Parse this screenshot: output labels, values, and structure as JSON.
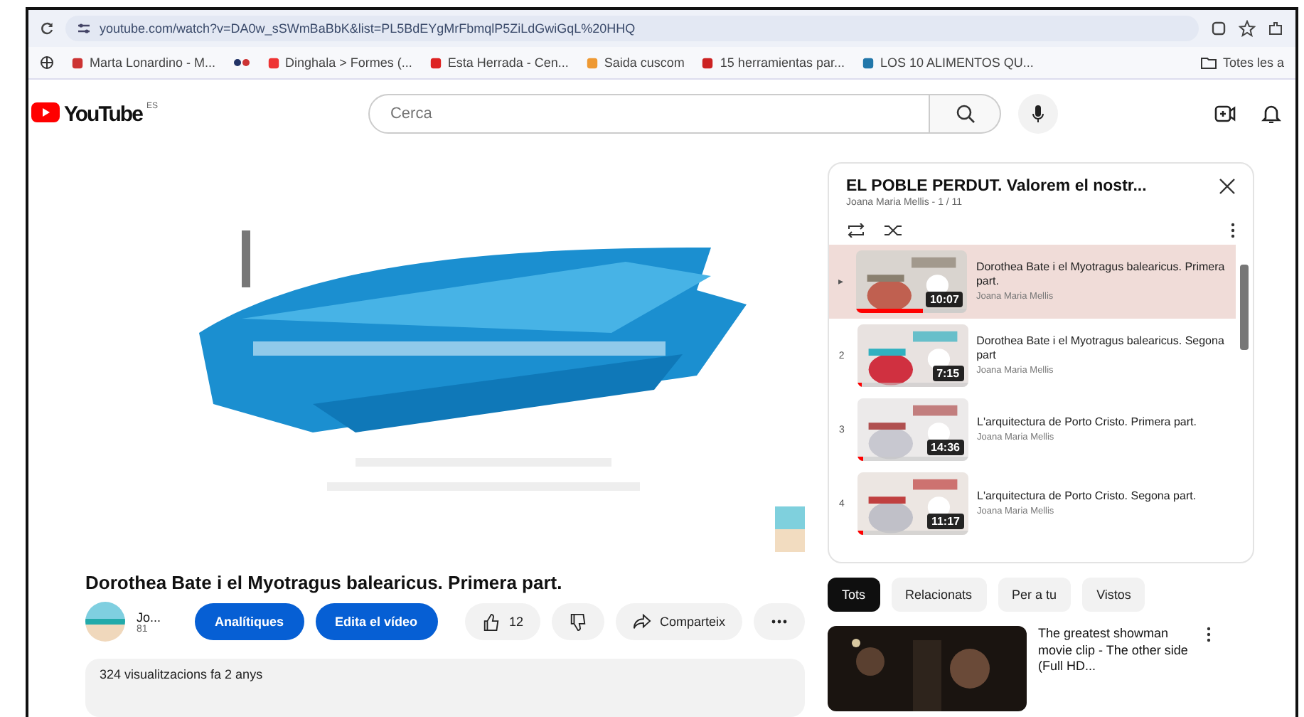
{
  "browser": {
    "url": "youtube.com/watch?v=DA0w_sSWmBaBbK&list=PL5BdEYgMrFbmqlP5ZiLdGwiGqL%20HHQ",
    "bookmarks": [
      {
        "label": "Marta Lonardino - M..."
      },
      {
        "label": "Dinghala > Formes (..."
      },
      {
        "label": "Esta Herrada - Cen..."
      },
      {
        "label": "Saida cuscom"
      },
      {
        "label": "15 herramientas par..."
      },
      {
        "label": "LOS 10 ALIMENTOS QU..."
      }
    ],
    "folder": "Totes les a"
  },
  "header": {
    "logo": "YouTube",
    "region": "ES",
    "search_placeholder": "Cerca"
  },
  "video": {
    "title": "Dorothea Bate i el Myotragus balearicus. Primera part.",
    "channel": "Jo...",
    "subscribers": "81",
    "buttons": [
      "Analítiques",
      "Edita el vídeo"
    ],
    "likes": "12",
    "share": "Comparteix",
    "description": "324 visualitzacions fa 2 anys"
  },
  "playlist": {
    "title": "EL POBLE PERDUT. Valorem el nostr...",
    "subtitle": "Joana Maria Mellis - 1 / 11",
    "items": [
      {
        "marker": "▸",
        "title": "Dorothea Bate i el Myotragus balearicus. Primera part.",
        "channel": "Joana Maria Mellis",
        "duration": "10:07",
        "selected": true,
        "level": 0.6
      },
      {
        "marker": "2",
        "title": "Dorothea Bate i el Myotragus balearicus. Segona part",
        "channel": "Joana Maria Mellis",
        "duration": "7:15",
        "selected": false,
        "level": 0.05
      },
      {
        "marker": "3",
        "title": "L'arquitectura de Porto Cristo. Primera part.",
        "channel": "Joana Maria Mellis",
        "duration": "14:36",
        "selected": false,
        "level": 0.05
      },
      {
        "marker": "4",
        "title": "L'arquitectura de Porto Cristo. Segona part.",
        "channel": "Joana Maria Mellis",
        "duration": "11:17",
        "selected": false,
        "level": 0.05
      }
    ]
  },
  "chips": [
    {
      "label": "Tots",
      "selected": true
    },
    {
      "label": "Relacionats",
      "selected": false
    },
    {
      "label": "Per a tu",
      "selected": false
    },
    {
      "label": "Vistos",
      "selected": false
    }
  ],
  "related": [
    {
      "title": "The greatest showman movie clip - The other side (Full HD..."
    }
  ]
}
